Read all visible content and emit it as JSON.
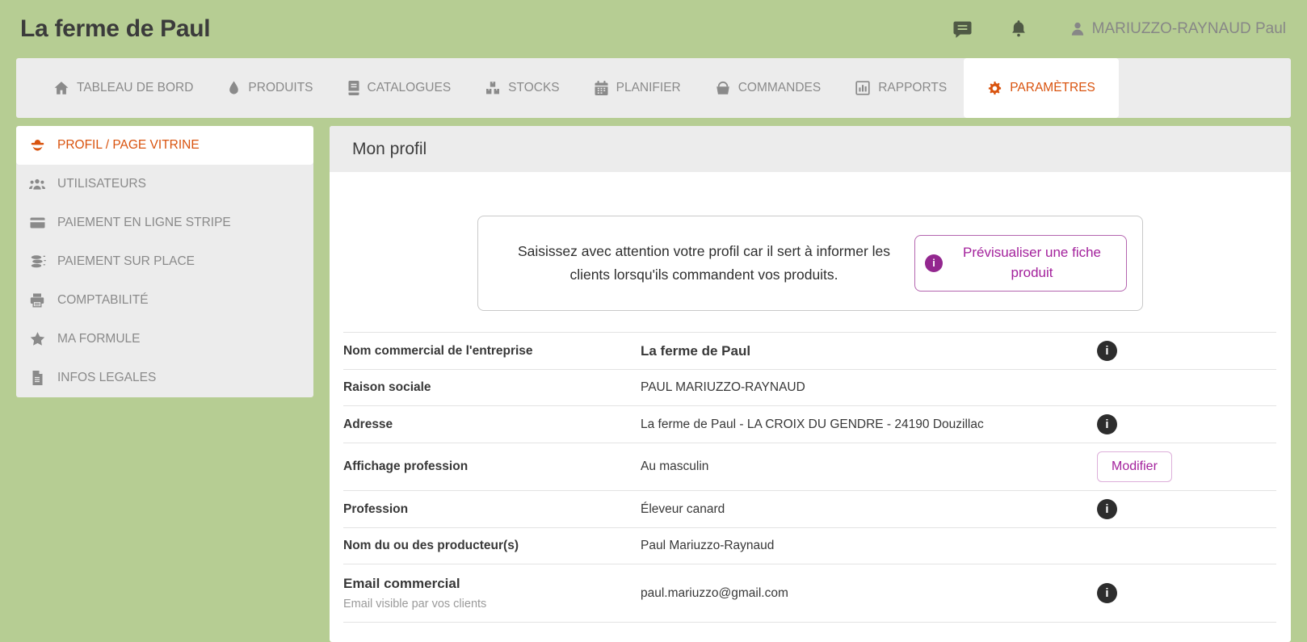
{
  "header": {
    "title": "La ferme de Paul",
    "user_name": "MARIUZZO-RAYNAUD Paul",
    "icons": [
      "chat-icon",
      "bell-icon",
      "person-icon"
    ]
  },
  "nav": {
    "items": [
      {
        "label": "TABLEAU DE BORD",
        "icon": "home-icon",
        "active": false
      },
      {
        "label": "PRODUITS",
        "icon": "droplet-icon",
        "active": false
      },
      {
        "label": "CATALOGUES",
        "icon": "book-icon",
        "active": false
      },
      {
        "label": "STOCKS",
        "icon": "boxes-icon",
        "active": false
      },
      {
        "label": "PLANIFIER",
        "icon": "calendar-icon",
        "active": false
      },
      {
        "label": "COMMANDES",
        "icon": "basket-icon",
        "active": false
      },
      {
        "label": "RAPPORTS",
        "icon": "bar-chart-icon",
        "active": false
      },
      {
        "label": "PARAMÈTRES",
        "icon": "gear-icon",
        "active": true
      }
    ]
  },
  "sidebar": {
    "items": [
      {
        "label": "PROFIL / PAGE VITRINE",
        "icon": "farmer-icon",
        "active": true
      },
      {
        "label": "UTILISATEURS",
        "icon": "users-icon",
        "active": false
      },
      {
        "label": "PAIEMENT EN LIGNE STRIPE",
        "icon": "credit-card-icon",
        "active": false
      },
      {
        "label": "PAIEMENT SUR PLACE",
        "icon": "coins-icon",
        "active": false
      },
      {
        "label": "COMPTABILITÉ",
        "icon": "printer-icon",
        "active": false
      },
      {
        "label": "MA FORMULE",
        "icon": "star-icon",
        "active": false
      },
      {
        "label": "INFOS LEGALES",
        "icon": "document-icon",
        "active": false
      }
    ]
  },
  "main": {
    "section_title": "Mon profil",
    "notice": {
      "text": "Saisissez avec attention votre profil car il sert à informer les clients lorsqu'ils commandent vos produits.",
      "button_label": "Prévisualiser une fiche produit",
      "info_glyph": "i"
    },
    "info_glyph": "i",
    "profile_fields": [
      {
        "label": "Nom commercial de l'entreprise",
        "value": "La ferme de Paul",
        "info": true
      },
      {
        "label": "Raison sociale",
        "value": "PAUL MARIUZZO-RAYNAUD",
        "info": false
      },
      {
        "label": "Adresse",
        "value": "La ferme de Paul - LA CROIX DU GENDRE - 24190 Douzillac",
        "info": true
      },
      {
        "label": "Affichage profession",
        "value": "Au masculin",
        "action": "Modifier"
      },
      {
        "label": "Profession",
        "value": "Éleveur canard",
        "info": true
      },
      {
        "label": "Nom du ou des producteur(s)",
        "value": "Paul Mariuzzo-Raynaud",
        "info": false
      },
      {
        "label": "Email commercial",
        "sublabel": "Email visible par vos clients",
        "value": "paul.mariuzzo@gmail.com",
        "info": true
      }
    ]
  },
  "colors": {
    "page_green": "#b6cd93",
    "accent_orange": "#d9530e",
    "accent_purple": "#93278f",
    "panel_gray": "#ececec",
    "header_icon_green": "#4f5945"
  }
}
